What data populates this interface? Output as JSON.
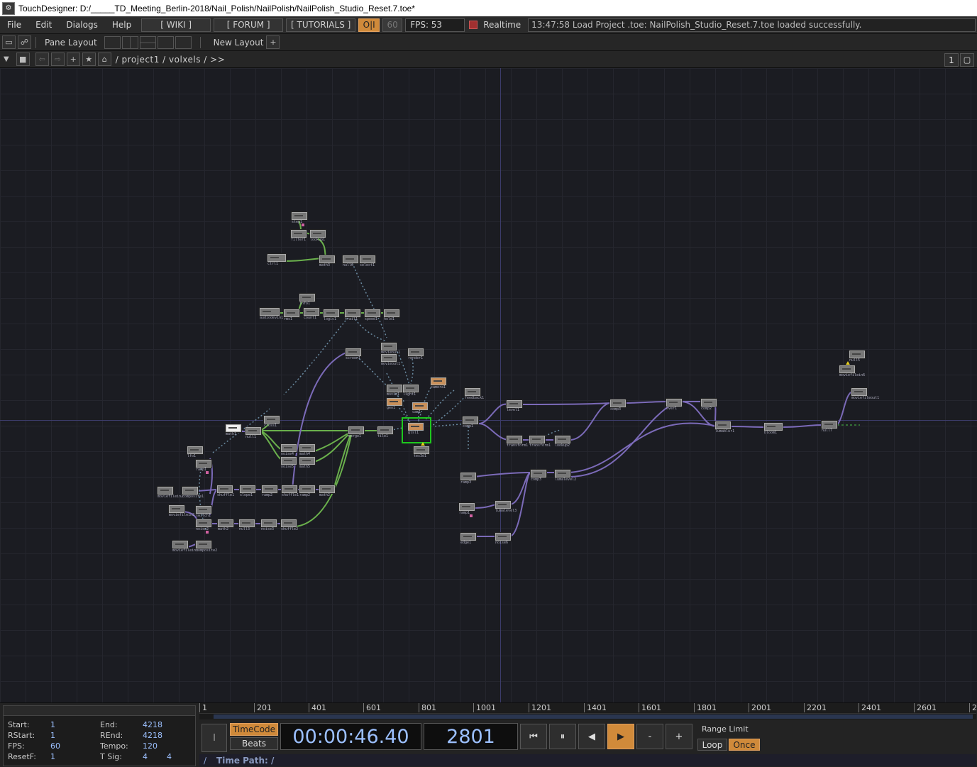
{
  "window": {
    "title": "TouchDesigner: D:/_____TD_Meeting_Berlin-2018/Nail_Polish/NailPolish/NailPolish_Studio_Reset.7.toe*",
    "icon": "touchdesigner-logo"
  },
  "menu": {
    "file": "File",
    "edit": "Edit",
    "dialogs": "Dialogs",
    "help": "Help"
  },
  "links": {
    "wiki": "[ WIKI ]",
    "forum": "[ FORUM ]",
    "tutorials": "[ TUTORIALS ]"
  },
  "perf": {
    "oi": "O|I",
    "fps_cap": "60",
    "fps": "FPS:  53",
    "realtime": "Realtime"
  },
  "status": {
    "message": "13:47:58 Load Project .toe: NailPolish_Studio_Reset.7.toe loaded successfully."
  },
  "toolbar": {
    "pane_layout": "Pane Layout",
    "new_layout": "New Layout",
    "add": "+"
  },
  "path": {
    "text": "/ project1 / volxels / >>",
    "pane_number": "1"
  },
  "nodes": [
    {
      "label": "step1"
    },
    {
      "label": "filter1"
    },
    {
      "label": "lookup1"
    },
    {
      "label": "ctrl1"
    },
    {
      "label": "math3"
    },
    {
      "label": "null6"
    },
    {
      "label": "select1"
    },
    {
      "label": "audiodevin1"
    },
    {
      "label": "rms1"
    },
    {
      "label": "count1"
    },
    {
      "label": "logic1"
    },
    {
      "label": "trail1"
    },
    {
      "label": "speed1"
    },
    {
      "label": "info1"
    },
    {
      "label": "hold1"
    },
    {
      "label": "screen1"
    },
    {
      "label": "movieout1"
    },
    {
      "label": "render1"
    },
    {
      "label": "camera1"
    },
    {
      "label": "movie1"
    },
    {
      "label": "light1"
    },
    {
      "label": "geo1"
    },
    {
      "label": "cam1"
    },
    {
      "label": "render2"
    },
    {
      "label": "tex3d1"
    },
    {
      "label": "glsl1"
    },
    {
      "label": "null2"
    },
    {
      "label": "feedback1"
    },
    {
      "label": "comp1"
    },
    {
      "label": "level1"
    },
    {
      "label": "blur1"
    },
    {
      "label": "over1"
    },
    {
      "label": "comp2"
    },
    {
      "label": "out1"
    },
    {
      "label": "ramp1"
    },
    {
      "label": "noise1"
    },
    {
      "label": "transform1"
    },
    {
      "label": "lookup2"
    },
    {
      "label": "lfo1"
    },
    {
      "label": "composite1"
    },
    {
      "label": "moviefilein2"
    },
    {
      "label": "noise2"
    },
    {
      "label": "moviefilein3"
    },
    {
      "label": "switch1"
    },
    {
      "label": "composite2"
    },
    {
      "label": "math1"
    },
    {
      "label": "null1"
    },
    {
      "label": "cross1"
    },
    {
      "label": "shuffle1"
    },
    {
      "label": "slope1"
    },
    {
      "label": "ramp2"
    },
    {
      "label": "math2"
    },
    {
      "label": "null3"
    },
    {
      "label": "noise3"
    },
    {
      "label": "shuffle2"
    },
    {
      "label": "noise4"
    },
    {
      "label": "noise5"
    },
    {
      "label": "math4"
    },
    {
      "label": "math5"
    },
    {
      "label": "merge1"
    },
    {
      "label": "null4"
    },
    {
      "label": "tile1"
    },
    {
      "label": "ramp3"
    },
    {
      "label": "comp3"
    },
    {
      "label": "lumablur1"
    },
    {
      "label": "lumalevel2"
    },
    {
      "label": "lumalevel3"
    },
    {
      "label": "noise6"
    },
    {
      "label": "edge1"
    },
    {
      "label": "bloom1"
    },
    {
      "label": "null5"
    },
    {
      "label": "moviefilein6"
    },
    {
      "label": "moviefileout1"
    },
    {
      "label": "null7"
    }
  ],
  "timeline": {
    "ticks": [
      "1",
      "201",
      "401",
      "601",
      "801",
      "1001",
      "1201",
      "1401",
      "1601",
      "1801",
      "2001",
      "2201",
      "2401",
      "2601",
      "2"
    ],
    "info": {
      "start_label": "Start:",
      "start": "1",
      "end_label": "End:",
      "end": "4218",
      "rstart_label": "RStart:",
      "rstart": "1",
      "rend_label": "REnd:",
      "rend": "4218",
      "fps_label": "FPS:",
      "fps": "60",
      "tempo_label": "Tempo:",
      "tempo": "120",
      "resetf_label": "ResetF:",
      "resetf": "1",
      "tsig_label": "T Sig:",
      "tsig_a": "4",
      "tsig_b": "4"
    },
    "cursor_glyph": "I",
    "timecode_btn": "TimeCode",
    "beats_btn": "Beats",
    "timecode": "00:00:46.40",
    "frame": "2801",
    "minus": "-",
    "plus": "+",
    "range_limit": "Range Limit",
    "loop": "Loop",
    "once": "Once",
    "time_path_prefix": "/",
    "time_path": "Time Path: /"
  },
  "colors": {
    "accent_orange": "#d08a3a",
    "select_green": "#1ec81e",
    "wire_purple": "#7b6ab8",
    "wire_green": "#6ab04c",
    "value_blue": "#9cc0ff"
  }
}
